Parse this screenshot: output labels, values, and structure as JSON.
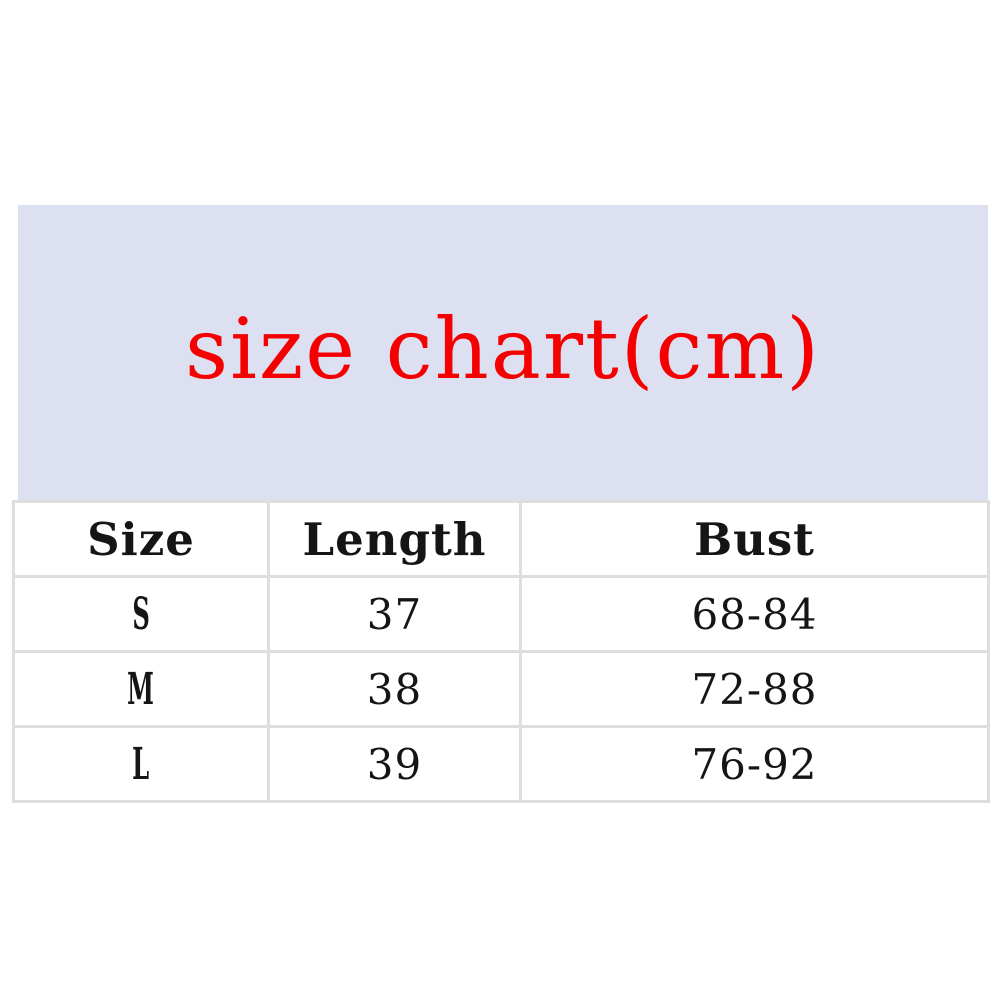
{
  "title": {
    "text": "size chart(cm)",
    "color": "#f40000",
    "background": "#dce0f1"
  },
  "table": {
    "headers": [
      "Size",
      "Length",
      "Bust"
    ],
    "rows": [
      {
        "size": "S",
        "length": "37",
        "bust": "68-84"
      },
      {
        "size": "M",
        "length": "38",
        "bust": "72-88"
      },
      {
        "size": "L",
        "length": "39",
        "bust": "76-92"
      }
    ],
    "border_color": "#dedede",
    "text_color": "#151515"
  },
  "chart_data": {
    "type": "table",
    "title": "size chart(cm)",
    "columns": [
      "Size",
      "Length",
      "Bust"
    ],
    "rows": [
      [
        "S",
        "37",
        "68-84"
      ],
      [
        "M",
        "38",
        "72-88"
      ],
      [
        "L",
        "39",
        "76-92"
      ]
    ],
    "units": "cm",
    "length_values": [
      37,
      38,
      39
    ],
    "bust_ranges": [
      [
        68,
        84
      ],
      [
        72,
        88
      ],
      [
        76,
        92
      ]
    ]
  }
}
